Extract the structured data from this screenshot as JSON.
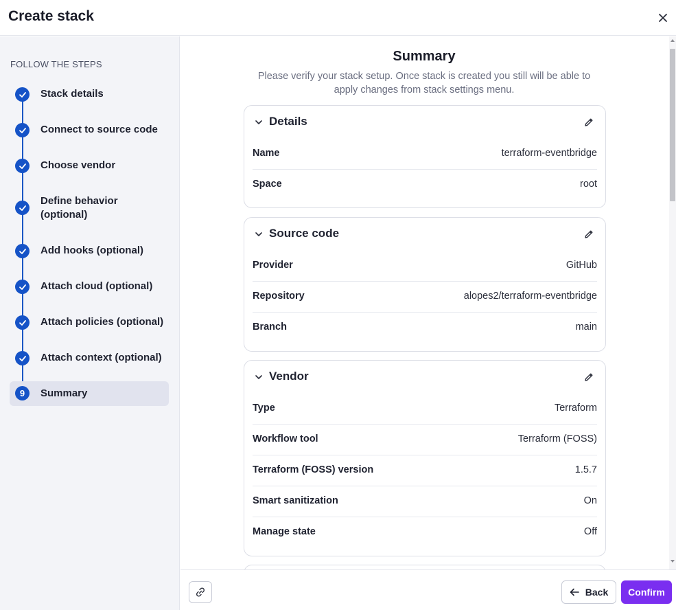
{
  "header": {
    "title": "Create stack",
    "close_icon": "close-icon"
  },
  "sidebar": {
    "heading": "FOLLOW THE STEPS",
    "steps": [
      {
        "label": "Stack details",
        "state": "done"
      },
      {
        "label": "Connect to source code",
        "state": "done"
      },
      {
        "label": "Choose vendor",
        "state": "done"
      },
      {
        "label": "Define behavior\n(optional)",
        "state": "done"
      },
      {
        "label": "Add hooks (optional)",
        "state": "done"
      },
      {
        "label": "Attach cloud (optional)",
        "state": "done"
      },
      {
        "label": "Attach policies (optional)",
        "state": "done"
      },
      {
        "label": "Attach context (optional)",
        "state": "done"
      },
      {
        "label": "Summary",
        "state": "active",
        "number": "9"
      }
    ]
  },
  "main": {
    "title": "Summary",
    "subtitle": "Please verify your stack setup. Once stack is created you still will be able to apply changes from stack settings menu.",
    "sections": [
      {
        "title": "Details",
        "rows": [
          {
            "key": "Name",
            "value": "terraform-eventbridge"
          },
          {
            "key": "Space",
            "value": "root"
          }
        ]
      },
      {
        "title": "Source code",
        "rows": [
          {
            "key": "Provider",
            "value": "GitHub"
          },
          {
            "key": "Repository",
            "value": "alopes2/terraform-eventbridge"
          },
          {
            "key": "Branch",
            "value": "main"
          }
        ]
      },
      {
        "title": "Vendor",
        "rows": [
          {
            "key": "Type",
            "value": "Terraform"
          },
          {
            "key": "Workflow tool",
            "value": "Terraform (FOSS)"
          },
          {
            "key": "Terraform (FOSS) version",
            "value": "1.5.7"
          },
          {
            "key": "Smart sanitization",
            "value": "On"
          },
          {
            "key": "Manage state",
            "value": "Off"
          }
        ]
      }
    ]
  },
  "footer": {
    "link_icon": "link-icon",
    "back_label": "Back",
    "confirm_label": "Confirm"
  },
  "colors": {
    "step_done": "#1553c7",
    "confirm": "#7a2ef0",
    "sidebar_bg": "#f3f4f8"
  }
}
